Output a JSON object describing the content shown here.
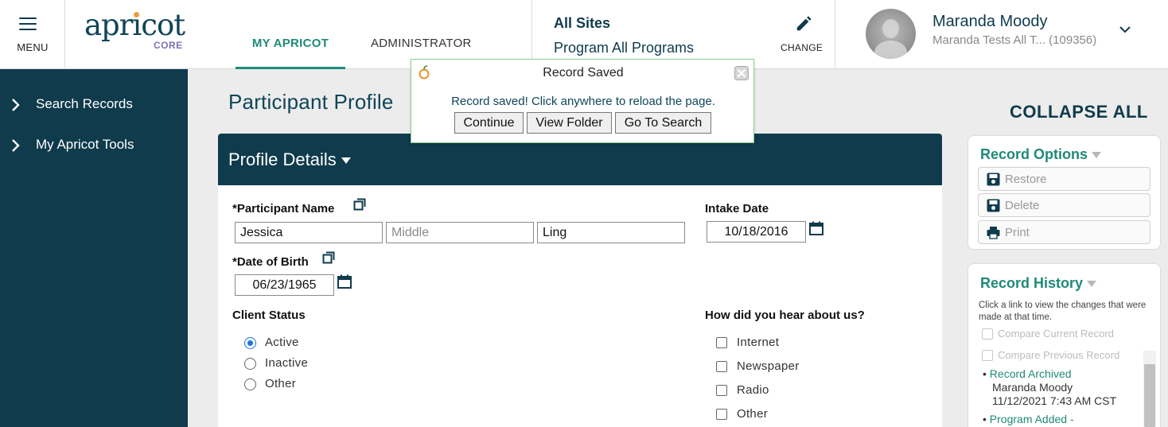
{
  "header": {
    "menu_label": "MENU",
    "logo_word": "apricot",
    "logo_sub": "CORE",
    "tabs": [
      {
        "label": "MY APRICOT",
        "active": true
      },
      {
        "label": "ADMINISTRATOR",
        "active": false
      }
    ],
    "site": {
      "title": "All Sites",
      "program": "Program All Programs",
      "change_label": "CHANGE"
    },
    "user": {
      "name": "Maranda Moody",
      "org": "Maranda Tests All T...  (109356)"
    }
  },
  "sidebar": {
    "items": [
      {
        "label": "Search Records"
      },
      {
        "label": "My Apricot Tools"
      }
    ]
  },
  "main": {
    "page_title": "Participant Profile",
    "collapse_all": "COLLAPSE ALL",
    "section_title": "Profile Details",
    "participant_name": {
      "label": "*Participant Name",
      "first": "Jessica",
      "middle_placeholder": "Middle",
      "last": "Ling"
    },
    "intake_date": {
      "label": "Intake Date",
      "value": "10/18/2016"
    },
    "dob": {
      "label": "*Date of Birth",
      "value": "06/23/1965"
    },
    "client_status": {
      "label": "Client Status",
      "options": [
        {
          "label": "Active",
          "selected": true
        },
        {
          "label": "Inactive",
          "selected": false
        },
        {
          "label": "Other",
          "selected": false
        }
      ]
    },
    "hear_about": {
      "label": "How did you hear about us?",
      "options": [
        {
          "label": "Internet",
          "checked": false
        },
        {
          "label": "Newspaper",
          "checked": false
        },
        {
          "label": "Radio",
          "checked": false
        },
        {
          "label": "Other",
          "checked": false
        }
      ]
    }
  },
  "record_options": {
    "title": "Record Options",
    "buttons": [
      {
        "label": "Restore",
        "icon": "save-icon"
      },
      {
        "label": "Delete",
        "icon": "save-icon"
      },
      {
        "label": "Print",
        "icon": "printer-icon"
      }
    ]
  },
  "record_history": {
    "title": "Record History",
    "note": "Click a link to view the changes that were made at that time.",
    "compare_current": "Compare Current Record",
    "compare_previous": "Compare Previous Record",
    "entries": [
      {
        "action": "Record Archived",
        "user": "Maranda Moody",
        "time": "11/12/2021 7:43 AM CST"
      },
      {
        "action": "Program Added -"
      }
    ]
  },
  "popup": {
    "title": "Record Saved",
    "message": "Record saved! Click anywhere to reload the page.",
    "buttons": {
      "continue": "Continue",
      "view_folder": "View Folder",
      "go_to_search": "Go To Search"
    }
  },
  "colors": {
    "navy": "#0f3b4c",
    "teal_accent": "#1f8a78",
    "logo_purple": "#7b72b7",
    "popup_border": "#8fd18f",
    "radio_blue": "#1a73e8"
  }
}
